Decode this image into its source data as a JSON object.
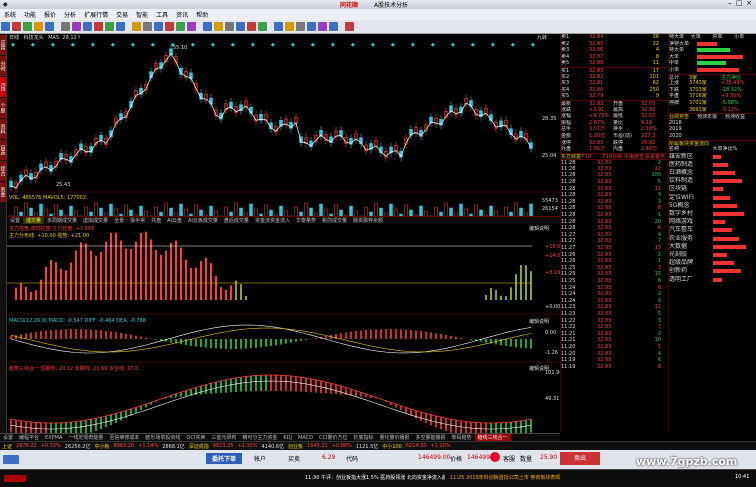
{
  "window": {
    "title": "A股技术分析",
    "brand": "同花顺"
  },
  "menu": [
    "系统",
    "功能",
    "报价",
    "分析",
    "扩展行情",
    "交易",
    "智能",
    "工具",
    "资讯",
    "帮助"
  ],
  "main_header": {
    "code": "日线",
    "name": "科技龙头",
    "ma": "MA5: 28.12↑",
    "right_label": "九转"
  },
  "price_labels": {
    "high": "55.10",
    "low": "25.43",
    "right_top": "28.35",
    "right_mid": "25.04"
  },
  "volume_header": "VOL: 465576  MAVOL5: 177002",
  "vol_right": [
    "55473",
    "26154"
  ],
  "indicator_tabs": [
    "设置",
    "成交量",
    "多周期成交量",
    "虚拟成交量",
    "全景",
    "操手常",
    "共盘",
    "AI云盘",
    "AI云板成交量",
    "盘后成交量",
    "资金流资金流入",
    "华泰量势",
    "税前成交量",
    "融资融券余额"
  ],
  "panel2": {
    "title": "主力控盘-高低控盘  主力控盘: +7.693",
    "sub": "主力分布线: +10.00  强势: +21.00",
    "scale": [
      "+18.01",
      "+14.04",
      "+8.19",
      "+0.00"
    ],
    "link": "编辑说明"
  },
  "panel3": {
    "title": "MACD(12,26,9)  MACD: -0.547  DIFF: -0.464  DEA: -0.788",
    "scale": [
      "0.00",
      "-1.26"
    ],
    "link": "编辑说明"
  },
  "panel4": {
    "title": "趋势三线合一  短期线: 20.12  长期线: 21.69  多空线: 37.0",
    "scale": [
      "101.94",
      "49.31"
    ],
    "link": "编辑说明"
  },
  "bottom_tabs": [
    "设置",
    "编程平台",
    "EXPMA",
    "一线定观奇能量",
    "至信维修成本",
    "欧乐场单投资线",
    "OCI买卖",
    "三金元研判",
    "精可分主力资金",
    "KDJ",
    "MACD",
    "CCI量价方位",
    "抄底指标",
    "量化量价播报",
    "多空量能播报",
    "筹码趋势",
    "趋线三线合一"
  ],
  "stockbar": [
    "上证",
    "2976.22",
    "+0.72%",
    "26256.2亿",
    "中小板",
    "8963.20",
    "+1.14%",
    "2868.1亿",
    "深证成指",
    "9873.25",
    "+1.35%",
    "4140.6亿",
    "创业板",
    "1645.21",
    "+0.88%",
    "1121.5亿",
    "中小100",
    "6214.30",
    "+1.20%"
  ],
  "order": {
    "labels": [
      "委托下单",
      "帐户",
      "买卖",
      "代码",
      "价格",
      "数量"
    ],
    "values": [
      "6.29",
      "146499.00",
      "31.18",
      "146499.00",
      "25.90"
    ],
    "help": "客服",
    "sell_label": "卖出"
  },
  "status": {
    "ticker": "11:30 午评：创业板指大涨1.5% 医药股领涨 北向资金净流入超50亿",
    "ticker2": "11:25 2019年科创板首批公司上市 券商板块表现活跃",
    "clock": "10:41"
  },
  "quote": {
    "top_labels": [
      "卖5",
      "卖4",
      "卖3",
      "卖2",
      "卖1",
      "买1",
      "买2",
      "买3",
      "买4",
      "买5"
    ],
    "sell": [
      [
        "32.88",
        "11"
      ],
      [
        "32.87",
        "8"
      ],
      [
        "32.86",
        "4"
      ],
      [
        "32.85",
        "22"
      ],
      [
        "32.84",
        "36"
      ]
    ],
    "buy": [
      [
        "32.83",
        "17"
      ],
      [
        "32.82",
        "101"
      ],
      [
        "32.81",
        "62"
      ],
      [
        "32.80",
        "250"
      ],
      [
        "32.79",
        "9"
      ]
    ],
    "fields": [
      [
        "最新",
        "32.83",
        "开盘",
        "32.03"
      ],
      [
        "涨跌",
        "+2.91",
        "最高",
        "32.83"
      ],
      [
        "涨幅",
        "+9.73%",
        "最低",
        "32.03"
      ],
      [
        "振幅",
        "2.67%",
        "量比",
        "9.18"
      ],
      [
        "总手",
        "3.51万",
        "换手",
        "2.18%"
      ],
      [
        "金额",
        "1.30亿",
        "市盈(动)",
        "227.3"
      ],
      [
        "涨停",
        "32.83",
        "跌停",
        "26.92"
      ],
      [
        "外盘",
        "1.05万",
        "内盘",
        "2.46万"
      ]
    ],
    "f10": [
      "东方财富",
      "F10",
      "F10诊断",
      "中报预告",
      "投资要点"
    ],
    "ticks": [
      [
        "11:28",
        "32.83",
        "2"
      ],
      [
        "11:28",
        "32.83",
        "12"
      ],
      [
        "11:28",
        "32.83",
        "100"
      ],
      [
        "11:28",
        "32.83",
        "5"
      ],
      [
        "11:28",
        "32.83",
        "11"
      ],
      [
        "11:28",
        "32.83",
        "9"
      ],
      [
        "11:28",
        "32.83",
        "3"
      ],
      [
        "11:28",
        "32.83",
        "8"
      ],
      [
        "11:28",
        "32.83",
        "1"
      ],
      [
        "11:28",
        "32.83",
        "20"
      ],
      [
        "11:28",
        "32.83",
        "6"
      ],
      [
        "11:27",
        "32.83",
        "4"
      ],
      [
        "11:27",
        "32.83",
        "7"
      ],
      [
        "11:27",
        "32.83",
        "13"
      ],
      [
        "11:26",
        "32.83",
        "2"
      ],
      [
        "11:26",
        "32.83",
        "1"
      ],
      [
        "11:25",
        "32.83",
        "3"
      ],
      [
        "11:25",
        "32.83",
        "15"
      ],
      [
        "11:25",
        "32.83",
        "8"
      ],
      [
        "11:24",
        "32.83",
        "6"
      ],
      [
        "11:24",
        "32.83",
        "2"
      ],
      [
        "11:24",
        "32.83",
        "9"
      ],
      [
        "11:23",
        "32.83",
        "12"
      ],
      [
        "11:23",
        "32.83",
        "5"
      ],
      [
        "11:22",
        "32.83",
        "3"
      ],
      [
        "11:22",
        "32.83",
        "7"
      ],
      [
        "11:21",
        "32.83",
        "2"
      ],
      [
        "11:21",
        "32.83",
        "10"
      ],
      [
        "11:20",
        "32.83",
        "1"
      ],
      [
        "11:20",
        "32.83",
        "4"
      ],
      [
        "11:19",
        "32.83",
        "6"
      ],
      [
        "11:19",
        "32.83",
        "8"
      ]
    ]
  },
  "flow": {
    "header": [
      "特大单",
      "大单",
      "中单",
      "小单"
    ],
    "rows": [
      [
        "净特大单",
        "",
        ""
      ],
      [
        "特大单",
        "",
        ""
      ],
      [
        "大单",
        "",
        ""
      ],
      [
        "中单",
        "",
        ""
      ],
      [
        "小单",
        "",
        ""
      ]
    ],
    "stats": [
      [
        "总计",
        "3家",
        "主力净比"
      ],
      [
        "上涨",
        "3743家",
        "+25.49%"
      ],
      [
        "下跌",
        "3703家",
        "-18.32%"
      ],
      [
        "平盘",
        "3716家",
        "+9.35%"
      ],
      [
        "停牌",
        "3701家",
        "-5.98%"
      ],
      [
        "",
        "3691家",
        "-3.12%"
      ]
    ],
    "tabs": [
      "业绩预告",
      "预测年报",
      "预测收益"
    ],
    "years": [
      "2018",
      "2019",
      "2020"
    ],
    "concept_title": "所属板块资金流向",
    "concept_hdr": [
      "名称",
      "大单净比%"
    ],
    "concepts": [
      "雄安新区",
      "医药制造",
      "白酒概念",
      "饮料制造",
      "区块链",
      "定位WIFI",
      "5G概念",
      "数字乡村",
      "网络游戏",
      "汽车整车",
      "农业服务",
      "大数据",
      "光刻胶",
      "超级品牌",
      "创新药",
      "透明工厂"
    ]
  },
  "watermark": "www.7gpzb.com",
  "colors": {
    "up": "#ff3b3b",
    "down": "#2ecf45",
    "ma": "#ffffff",
    "bg": "#000000"
  }
}
